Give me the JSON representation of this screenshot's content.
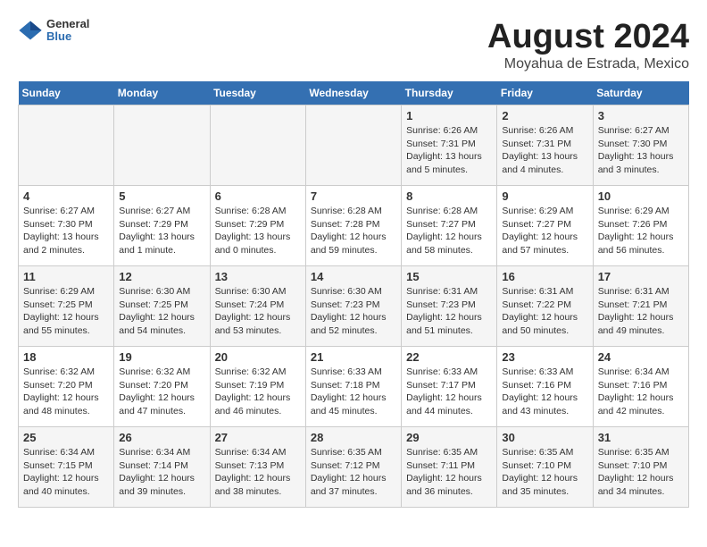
{
  "header": {
    "logo": {
      "general": "General",
      "blue": "Blue"
    },
    "title": "August 2024",
    "subtitle": "Moyahua de Estrada, Mexico"
  },
  "weekdays": [
    "Sunday",
    "Monday",
    "Tuesday",
    "Wednesday",
    "Thursday",
    "Friday",
    "Saturday"
  ],
  "weeks": [
    [
      {
        "day": "",
        "info": ""
      },
      {
        "day": "",
        "info": ""
      },
      {
        "day": "",
        "info": ""
      },
      {
        "day": "",
        "info": ""
      },
      {
        "day": "1",
        "info": "Sunrise: 6:26 AM\nSunset: 7:31 PM\nDaylight: 13 hours\nand 5 minutes."
      },
      {
        "day": "2",
        "info": "Sunrise: 6:26 AM\nSunset: 7:31 PM\nDaylight: 13 hours\nand 4 minutes."
      },
      {
        "day": "3",
        "info": "Sunrise: 6:27 AM\nSunset: 7:30 PM\nDaylight: 13 hours\nand 3 minutes."
      }
    ],
    [
      {
        "day": "4",
        "info": "Sunrise: 6:27 AM\nSunset: 7:30 PM\nDaylight: 13 hours\nand 2 minutes."
      },
      {
        "day": "5",
        "info": "Sunrise: 6:27 AM\nSunset: 7:29 PM\nDaylight: 13 hours\nand 1 minute."
      },
      {
        "day": "6",
        "info": "Sunrise: 6:28 AM\nSunset: 7:29 PM\nDaylight: 13 hours\nand 0 minutes."
      },
      {
        "day": "7",
        "info": "Sunrise: 6:28 AM\nSunset: 7:28 PM\nDaylight: 12 hours\nand 59 minutes."
      },
      {
        "day": "8",
        "info": "Sunrise: 6:28 AM\nSunset: 7:27 PM\nDaylight: 12 hours\nand 58 minutes."
      },
      {
        "day": "9",
        "info": "Sunrise: 6:29 AM\nSunset: 7:27 PM\nDaylight: 12 hours\nand 57 minutes."
      },
      {
        "day": "10",
        "info": "Sunrise: 6:29 AM\nSunset: 7:26 PM\nDaylight: 12 hours\nand 56 minutes."
      }
    ],
    [
      {
        "day": "11",
        "info": "Sunrise: 6:29 AM\nSunset: 7:25 PM\nDaylight: 12 hours\nand 55 minutes."
      },
      {
        "day": "12",
        "info": "Sunrise: 6:30 AM\nSunset: 7:25 PM\nDaylight: 12 hours\nand 54 minutes."
      },
      {
        "day": "13",
        "info": "Sunrise: 6:30 AM\nSunset: 7:24 PM\nDaylight: 12 hours\nand 53 minutes."
      },
      {
        "day": "14",
        "info": "Sunrise: 6:30 AM\nSunset: 7:23 PM\nDaylight: 12 hours\nand 52 minutes."
      },
      {
        "day": "15",
        "info": "Sunrise: 6:31 AM\nSunset: 7:23 PM\nDaylight: 12 hours\nand 51 minutes."
      },
      {
        "day": "16",
        "info": "Sunrise: 6:31 AM\nSunset: 7:22 PM\nDaylight: 12 hours\nand 50 minutes."
      },
      {
        "day": "17",
        "info": "Sunrise: 6:31 AM\nSunset: 7:21 PM\nDaylight: 12 hours\nand 49 minutes."
      }
    ],
    [
      {
        "day": "18",
        "info": "Sunrise: 6:32 AM\nSunset: 7:20 PM\nDaylight: 12 hours\nand 48 minutes."
      },
      {
        "day": "19",
        "info": "Sunrise: 6:32 AM\nSunset: 7:20 PM\nDaylight: 12 hours\nand 47 minutes."
      },
      {
        "day": "20",
        "info": "Sunrise: 6:32 AM\nSunset: 7:19 PM\nDaylight: 12 hours\nand 46 minutes."
      },
      {
        "day": "21",
        "info": "Sunrise: 6:33 AM\nSunset: 7:18 PM\nDaylight: 12 hours\nand 45 minutes."
      },
      {
        "day": "22",
        "info": "Sunrise: 6:33 AM\nSunset: 7:17 PM\nDaylight: 12 hours\nand 44 minutes."
      },
      {
        "day": "23",
        "info": "Sunrise: 6:33 AM\nSunset: 7:16 PM\nDaylight: 12 hours\nand 43 minutes."
      },
      {
        "day": "24",
        "info": "Sunrise: 6:34 AM\nSunset: 7:16 PM\nDaylight: 12 hours\nand 42 minutes."
      }
    ],
    [
      {
        "day": "25",
        "info": "Sunrise: 6:34 AM\nSunset: 7:15 PM\nDaylight: 12 hours\nand 40 minutes."
      },
      {
        "day": "26",
        "info": "Sunrise: 6:34 AM\nSunset: 7:14 PM\nDaylight: 12 hours\nand 39 minutes."
      },
      {
        "day": "27",
        "info": "Sunrise: 6:34 AM\nSunset: 7:13 PM\nDaylight: 12 hours\nand 38 minutes."
      },
      {
        "day": "28",
        "info": "Sunrise: 6:35 AM\nSunset: 7:12 PM\nDaylight: 12 hours\nand 37 minutes."
      },
      {
        "day": "29",
        "info": "Sunrise: 6:35 AM\nSunset: 7:11 PM\nDaylight: 12 hours\nand 36 minutes."
      },
      {
        "day": "30",
        "info": "Sunrise: 6:35 AM\nSunset: 7:10 PM\nDaylight: 12 hours\nand 35 minutes."
      },
      {
        "day": "31",
        "info": "Sunrise: 6:35 AM\nSunset: 7:10 PM\nDaylight: 12 hours\nand 34 minutes."
      }
    ]
  ]
}
